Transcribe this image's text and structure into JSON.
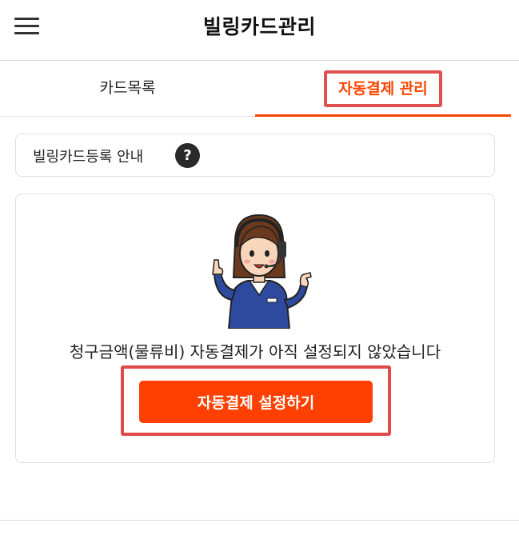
{
  "header": {
    "title": "빌링카드관리",
    "menu_icon": "hamburger-menu-icon"
  },
  "tabs": [
    {
      "label": "카드목록",
      "active": false
    },
    {
      "label": "자동결제 관리",
      "active": true
    }
  ],
  "guide": {
    "label": "빌링카드등록 안내",
    "help_glyph": "?",
    "icon": "help-question-icon"
  },
  "empty_state": {
    "illustration": "customer-service-agent-illustration",
    "message": "청구금액(물류비) 자동결제가 아직 설정되지 않았습니다",
    "button_label": "자동결제 설정하기"
  },
  "colors": {
    "accent": "#ff4000",
    "highlight_box": "#e04a4a",
    "text": "#222222"
  }
}
